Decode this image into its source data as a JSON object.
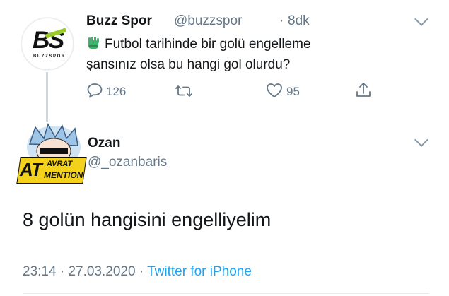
{
  "tweet1": {
    "display_name": "Buzz Spor",
    "handle": "@buzzspor",
    "separator": "·",
    "time": "8dk",
    "avatar": {
      "logo_text": "BS",
      "sub_text": "BUZZSPOR",
      "accent": "#9ccc2c"
    },
    "text_line1": "Futbol tarihinde bir golü engelleme",
    "text_line2": "şansınız olsa bu hangi gol olurdu?",
    "emoji": "goalkeeper-glove",
    "actions": {
      "reply_count": "126",
      "retweet_count": "",
      "like_count": "95"
    }
  },
  "tweet2": {
    "display_name": "Ozan",
    "handle": "@_ozanbaris",
    "avatar": {
      "big": "AT",
      "top": "AVRAT",
      "bottom": "MENTION",
      "bg": "#f4d21b"
    },
    "text": "8 golün hangisini engelliyelim",
    "meta": {
      "time": "23:14",
      "date": "27.03.2020",
      "separator": "·",
      "source": "Twitter for iPhone"
    }
  },
  "colors": {
    "text": "#14171a",
    "secondary": "#657786",
    "link": "#1da1f2",
    "thread_line": "#cdd6dd"
  }
}
